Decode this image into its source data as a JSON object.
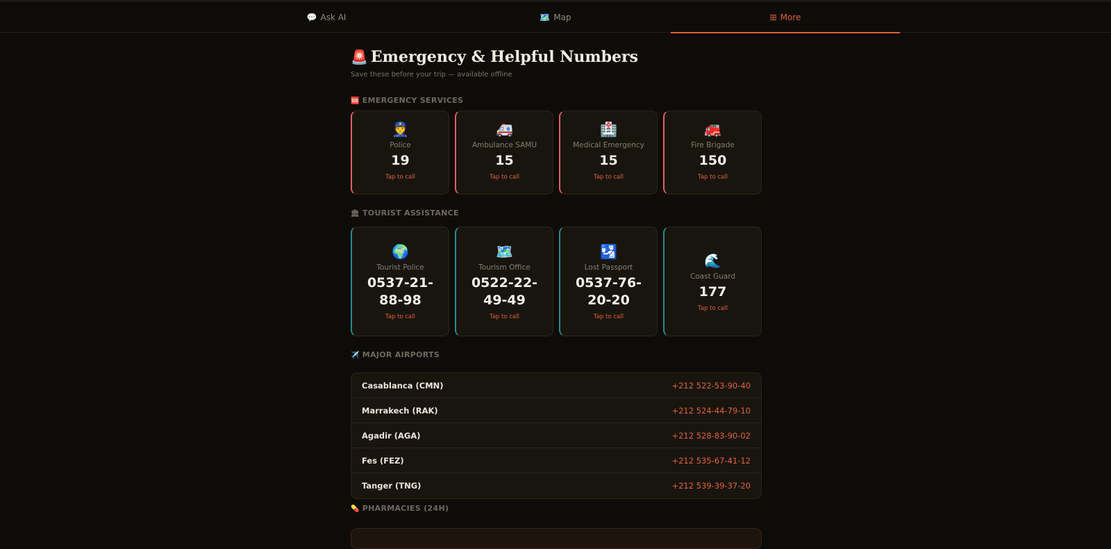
{
  "tabs": [
    {
      "icon": "💬",
      "label": "Ask AI"
    },
    {
      "icon": "🗺️",
      "label": "Map"
    },
    {
      "icon": "⊞",
      "label": "More"
    }
  ],
  "page": {
    "icon": "🚨",
    "title": "Emergency & Helpful Numbers",
    "subtitle": "Save these before your trip — available offline"
  },
  "sections": {
    "emergency": {
      "icon": "🆘",
      "label": "EMERGENCY SERVICES"
    },
    "tourist": {
      "icon": "🏛",
      "label": "TOURIST ASSISTANCE"
    },
    "airports": {
      "icon": "✈️",
      "label": "MAJOR AIRPORTS"
    },
    "pharmacies": {
      "icon": "💊",
      "label": "PHARMACIES (24H)"
    }
  },
  "emergency_cards": [
    {
      "icon": "👮",
      "label": "Police",
      "number": "19",
      "action": "Tap to call"
    },
    {
      "icon": "🚑",
      "label": "Ambulance SAMU",
      "number": "15",
      "action": "Tap to call"
    },
    {
      "icon": "🏥",
      "label": "Medical Emergency",
      "number": "15",
      "action": "Tap to call"
    },
    {
      "icon": "🚒",
      "label": "Fire Brigade",
      "number": "150",
      "action": "Tap to call"
    }
  ],
  "tourist_cards": [
    {
      "icon": "🌍",
      "label": "Tourist Police",
      "number": "0537-21-88-98",
      "action": "Tap to call"
    },
    {
      "icon": "🗺️",
      "label": "Tourism Office",
      "number": "0522-22-49-49",
      "action": "Tap to call"
    },
    {
      "icon": "🛂",
      "label": "Lost Passport",
      "number": "0537-76-20-20",
      "action": "Tap to call"
    },
    {
      "icon": "🌊",
      "label": "Coast Guard",
      "number": "177",
      "action": "Tap to call"
    }
  ],
  "airports": [
    {
      "name": "Casablanca (CMN)",
      "phone": "+212 522-53-90-40"
    },
    {
      "name": "Marrakech (RAK)",
      "phone": "+212 524-44-79-10"
    },
    {
      "name": "Agadir (AGA)",
      "phone": "+212 528-83-90-02"
    },
    {
      "name": "Fes (FEZ)",
      "phone": "+212 535-67-41-12"
    },
    {
      "name": "Tanger (TNG)",
      "phone": "+212 539-39-37-20"
    }
  ]
}
